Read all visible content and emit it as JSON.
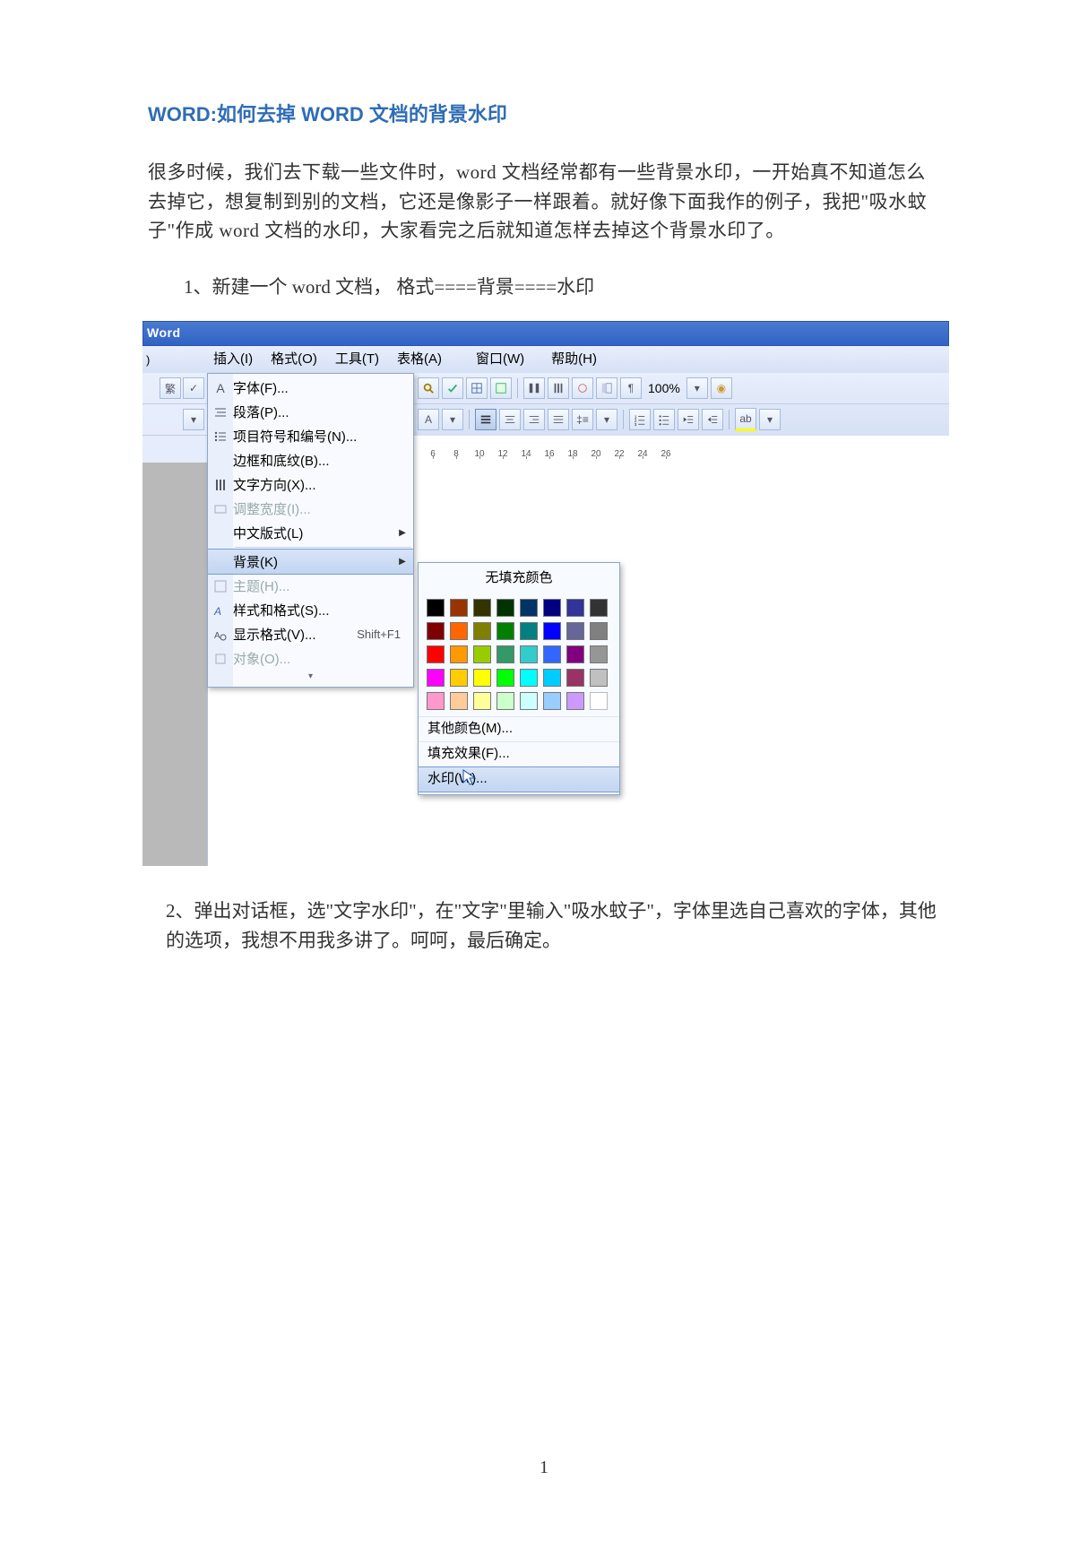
{
  "title": {
    "prefix": "WORD:",
    "part1": "如何去掉 ",
    "bold": "WORD ",
    "part2": "文档的背景水印"
  },
  "paragraph1": "很多时候，我们去下载一些文件时，word 文档经常都有一些背景水印，一开始真不知道怎么去掉它，想复制到别的文档，它还是像影子一样跟着。就好像下面我作的例子，我把\"吸水蚊子\"作成 word 文档的水印，大家看完之后就知道怎样去掉这个背景水印了。",
  "step1": "1、新建一个 word 文档，  格式====背景====水印",
  "step2": "2、弹出对话框，选\"文字水印\"，在\"文字\"里输入\"吸水蚊子\"，字体里选自己喜欢的字体，其他的选项，我想不用我多讲了。呵呵，最后确定。",
  "page_number": "1",
  "word_ui": {
    "titlebar": "Word",
    "menubar": {
      "left_fragment": ")",
      "insert": "插入(I)",
      "format": "格式(O)",
      "tools": "工具(T)",
      "table": "表格(A)",
      "window": "窗口(W)",
      "help": "帮助(H)"
    },
    "format_menu": [
      {
        "icon": "font",
        "label": "字体(F)...",
        "enabled": true
      },
      {
        "icon": "para",
        "label": "段落(P)...",
        "enabled": true
      },
      {
        "icon": "bullets",
        "label": "项目符号和编号(N)...",
        "enabled": true
      },
      {
        "icon": "",
        "label": "边框和底纹(B)...",
        "enabled": true
      },
      {
        "icon": "textdir",
        "label": "文字方向(X)...",
        "enabled": true
      },
      {
        "icon": "colwidth",
        "label": "调整宽度(I)...",
        "enabled": false
      },
      {
        "icon": "",
        "label": "中文版式(L)",
        "arrow": true,
        "enabled": true
      },
      {
        "sep": true
      },
      {
        "icon": "",
        "label": "背景(K)",
        "arrow": true,
        "highlight": true,
        "enabled": true
      },
      {
        "icon": "theme",
        "label": "主题(H)...",
        "enabled": false
      },
      {
        "icon": "styles",
        "label": "样式和格式(S)...",
        "enabled": true
      },
      {
        "icon": "reveal",
        "label": "显示格式(V)...",
        "shortcut": "Shift+F1",
        "enabled": true
      },
      {
        "icon": "object",
        "label": "对象(O)...",
        "enabled": false
      }
    ],
    "zoom": "100%",
    "ruler_ticks": [
      "6",
      "8",
      "10",
      "12",
      "14",
      "16",
      "18",
      "20",
      "22",
      "24",
      "26"
    ],
    "bg_submenu": {
      "no_fill": "无填充颜色",
      "palette": [
        "#000000",
        "#993300",
        "#333300",
        "#003300",
        "#003366",
        "#000080",
        "#333399",
        "#333333",
        "#800000",
        "#ff6600",
        "#808000",
        "#008000",
        "#008080",
        "#0000ff",
        "#666699",
        "#808080",
        "#ff0000",
        "#ff9900",
        "#99cc00",
        "#339966",
        "#33cccc",
        "#3366ff",
        "#800080",
        "#969696",
        "#ff00ff",
        "#ffcc00",
        "#ffff00",
        "#00ff00",
        "#00ffff",
        "#00ccff",
        "#993366",
        "#c0c0c0",
        "#ff99cc",
        "#ffcc99",
        "#ffff99",
        "#ccffcc",
        "#ccffff",
        "#99ccff",
        "#cc99ff",
        "#ffffff"
      ],
      "more_colors": "其他颜色(M)...",
      "fill_effects": "填充效果(F)...",
      "watermark": "水印(W)..."
    }
  }
}
